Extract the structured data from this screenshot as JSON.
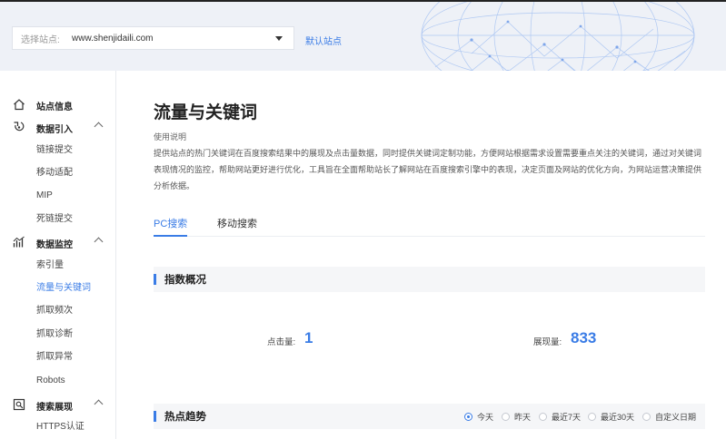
{
  "header": {
    "site_label": "选择站点:",
    "site_value": "www.shenjidaili.com",
    "default_site": "默认站点"
  },
  "sidebar": {
    "groups": [
      {
        "label": "站点信息",
        "icon": "home-icon"
      },
      {
        "label": "数据引入",
        "icon": "data-import-icon",
        "items": [
          "链接提交",
          "移动适配",
          "MIP",
          "死链提交"
        ]
      },
      {
        "label": "数据监控",
        "icon": "monitor-chart-icon",
        "items": [
          "索引量",
          "流量与关键词",
          "抓取频次",
          "抓取诊断",
          "抓取异常",
          "Robots"
        ]
      },
      {
        "label": "搜索展现",
        "icon": "search-display-icon",
        "items": [
          "HTTPS认证"
        ]
      }
    ],
    "active_item": "流量与关键词"
  },
  "main": {
    "title": "流量与关键词",
    "usage_title": "使用说明",
    "usage_desc": "提供站点的热门关键词在百度搜索结果中的展现及点击量数据，同时提供关键词定制功能，方便网站根据需求设置需要重点关注的关键词，通过对关键词表现情况的监控，帮助网站更好进行优化，工具旨在全面帮助站长了解网站在百度搜索引擎中的表现，决定页面及网站的优化方向，为网站运营决策提供分析依据。",
    "tabs": [
      "PC搜索",
      "移动搜索"
    ],
    "index_section": "指数概况",
    "clicks_label": "点击量:",
    "clicks_value": "1",
    "impressions_label": "展现量:",
    "impressions_value": "833",
    "trend_section": "热点趋势",
    "ranges": [
      "今天",
      "昨天",
      "最近7天",
      "最近30天",
      "自定义日期"
    ],
    "selected_range": "今天"
  },
  "colors": {
    "accent": "#3a7ce6",
    "header_bg": "#eef1f7",
    "section_bg": "#f5f6f8"
  }
}
